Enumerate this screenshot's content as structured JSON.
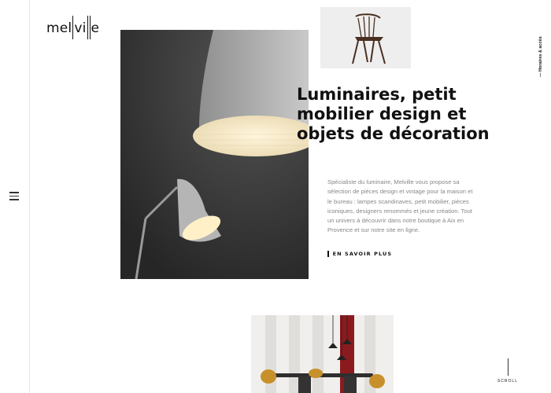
{
  "brand": {
    "logo_text": "melville"
  },
  "nav": {
    "hours_link": "— Horaires & accès",
    "menu_icon": "hamburger-icon"
  },
  "hero": {
    "title": "Luminaires, petit mobilier design et objets de décoration",
    "description": "Spécialiste du luminaire, Melville vous propose sa sélection de pièces design et vintage pour la maison et le bureau : lampes scandinaves, petit mobilier, pièces iconiques, designers renommés et jeune création. Tout un univers à découvrir dans notre boutique à Aix en Provence et sur notre site en ligne.",
    "cta_label": "EN SAVOIR PLUS"
  },
  "scroll": {
    "label": "SCROLL"
  },
  "colors": {
    "text": "#111111",
    "muted": "#888888",
    "photo_dark": "#3b3b3b",
    "accent_red": "#8b1a1f"
  }
}
